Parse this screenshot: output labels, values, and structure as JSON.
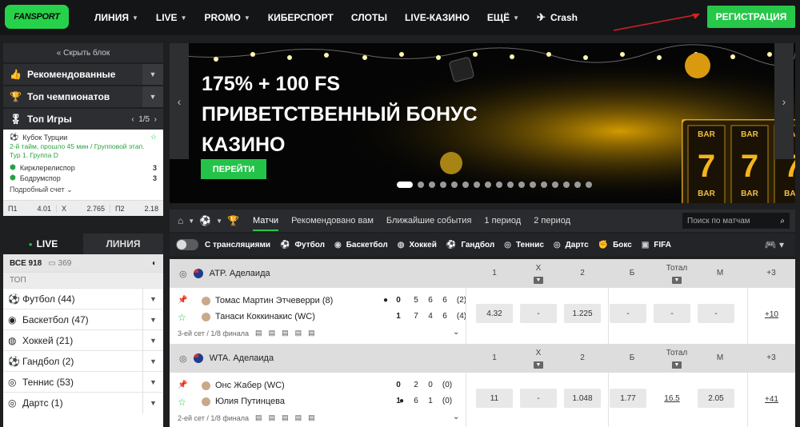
{
  "header": {
    "logo": "FANSPORT",
    "nav": [
      {
        "label": "ЛИНИЯ",
        "chevron": true
      },
      {
        "label": "LIVE",
        "chevron": true
      },
      {
        "label": "PROMO",
        "chevron": true
      },
      {
        "label": "КИБЕРСПОРТ",
        "chevron": false
      },
      {
        "label": "СЛОТЫ",
        "chevron": false
      },
      {
        "label": "LIVE-КАЗИНО",
        "chevron": false
      },
      {
        "label": "ЕЩЁ",
        "chevron": true
      },
      {
        "label": "Crash",
        "chevron": false
      }
    ],
    "register": "РЕГИСТРАЦИЯ"
  },
  "sidebar": {
    "hide_block": "« Скрыть блок",
    "recommended": "Рекомендованные",
    "top_championships": "Топ чемпионатов",
    "top_games": "Топ Игры",
    "top_games_page": "1/5",
    "game": {
      "league": "Кубок Турции",
      "status": "2-й тайм, прошло 45 мин / Групповой этап. Тур 1. Группа D",
      "team1": "Кирклерелиспор",
      "score1": "3",
      "team2": "Бодрумспор",
      "score2": "3",
      "detail": "Подробный счет",
      "odds": [
        {
          "label": "П1",
          "value": "4.01"
        },
        {
          "label": "X",
          "value": "2.765"
        },
        {
          "label": "П2",
          "value": "2.18"
        }
      ]
    },
    "live_tab": "LIVE",
    "line_tab": "ЛИНИЯ",
    "all_label": "ВСЕ 918",
    "all_count": "369",
    "top_label": "ТОП",
    "sports": [
      {
        "icon": "football-icon",
        "label": "Футбол (44)",
        "glyph": "⚽"
      },
      {
        "icon": "basketball-icon",
        "label": "Баскетбол (47)",
        "glyph": "◉"
      },
      {
        "icon": "hockey-icon",
        "label": "Хоккей (21)",
        "glyph": "◍"
      },
      {
        "icon": "handball-icon",
        "label": "Гандбол (2)",
        "glyph": "⚽"
      },
      {
        "icon": "tennis-icon",
        "label": "Теннис (53)",
        "glyph": "◎"
      },
      {
        "icon": "darts-icon",
        "label": "Дартс (1)",
        "glyph": "◎"
      }
    ]
  },
  "banner": {
    "line1": "175% + 100 FS",
    "line2": "ПРИВЕТСТВЕННЫЙ БОНУС",
    "line3": "КАЗИНО",
    "button": "ПЕРЕЙТИ",
    "reel_label": "BAR",
    "reel_symbol": "7",
    "slide_count": 17
  },
  "tabs": {
    "items": [
      "Матчи",
      "Рекомендовано вам",
      "Ближайшие события",
      "1 период",
      "2 период"
    ],
    "active": 0,
    "search_placeholder": "Поиск по матчам"
  },
  "filters": {
    "stream_label": "С трансляциями",
    "sports": [
      {
        "icon": "football-icon",
        "label": "Футбол"
      },
      {
        "icon": "basketball-icon",
        "label": "Баскетбол"
      },
      {
        "icon": "hockey-icon",
        "label": "Хоккей"
      },
      {
        "icon": "handball-icon",
        "label": "Гандбол"
      },
      {
        "icon": "tennis-icon",
        "label": "Теннис"
      },
      {
        "icon": "darts-icon",
        "label": "Дартс"
      },
      {
        "icon": "boxing-icon",
        "label": "Бокс"
      },
      {
        "icon": "fifa-icon",
        "label": "FIFA"
      }
    ]
  },
  "leagues": [
    {
      "name": "ATP. Аделаида",
      "cols": {
        "c1": "1",
        "cx": "X",
        "c2": "2",
        "b": "Б",
        "total": "Тотал",
        "m": "М",
        "more": "+3"
      },
      "match": {
        "p1": "Томас Мартин Этчеверри (8)",
        "p2": "Танаси Коккинакис (WC)",
        "p1_sets": "0",
        "p2_sets": "1",
        "p1_games": [
          "5",
          "6",
          "6",
          "(2)"
        ],
        "p2_games": [
          "7",
          "4",
          "6",
          "(4)"
        ],
        "info": "3-ей сет / 1/8 финала",
        "odds": [
          "4.32",
          "-",
          "1.225",
          "-",
          "-",
          "-"
        ],
        "total_line": "",
        "more": "+10"
      }
    },
    {
      "name": "WTA. Аделаида",
      "cols": {
        "c1": "1",
        "cx": "X",
        "c2": "2",
        "b": "Б",
        "total": "Тотал",
        "m": "М",
        "more": "+3"
      },
      "match": {
        "p1": "Онс Жабер (WC)",
        "p2": "Юлия Путинцева",
        "p1_sets": "0",
        "p2_sets": "1",
        "p1_games": [
          "2",
          "0",
          "(0)"
        ],
        "p2_games": [
          "6",
          "1",
          "(0)"
        ],
        "info": "2-ей сет / 1/8 финала",
        "odds": [
          "11",
          "-",
          "1.048",
          "1.77",
          "",
          "2.05"
        ],
        "total_line": "16.5",
        "more": "+41"
      }
    }
  ],
  "colors": {
    "accent": "#27c74a",
    "header": "#141517",
    "background": "#1e1f21"
  }
}
